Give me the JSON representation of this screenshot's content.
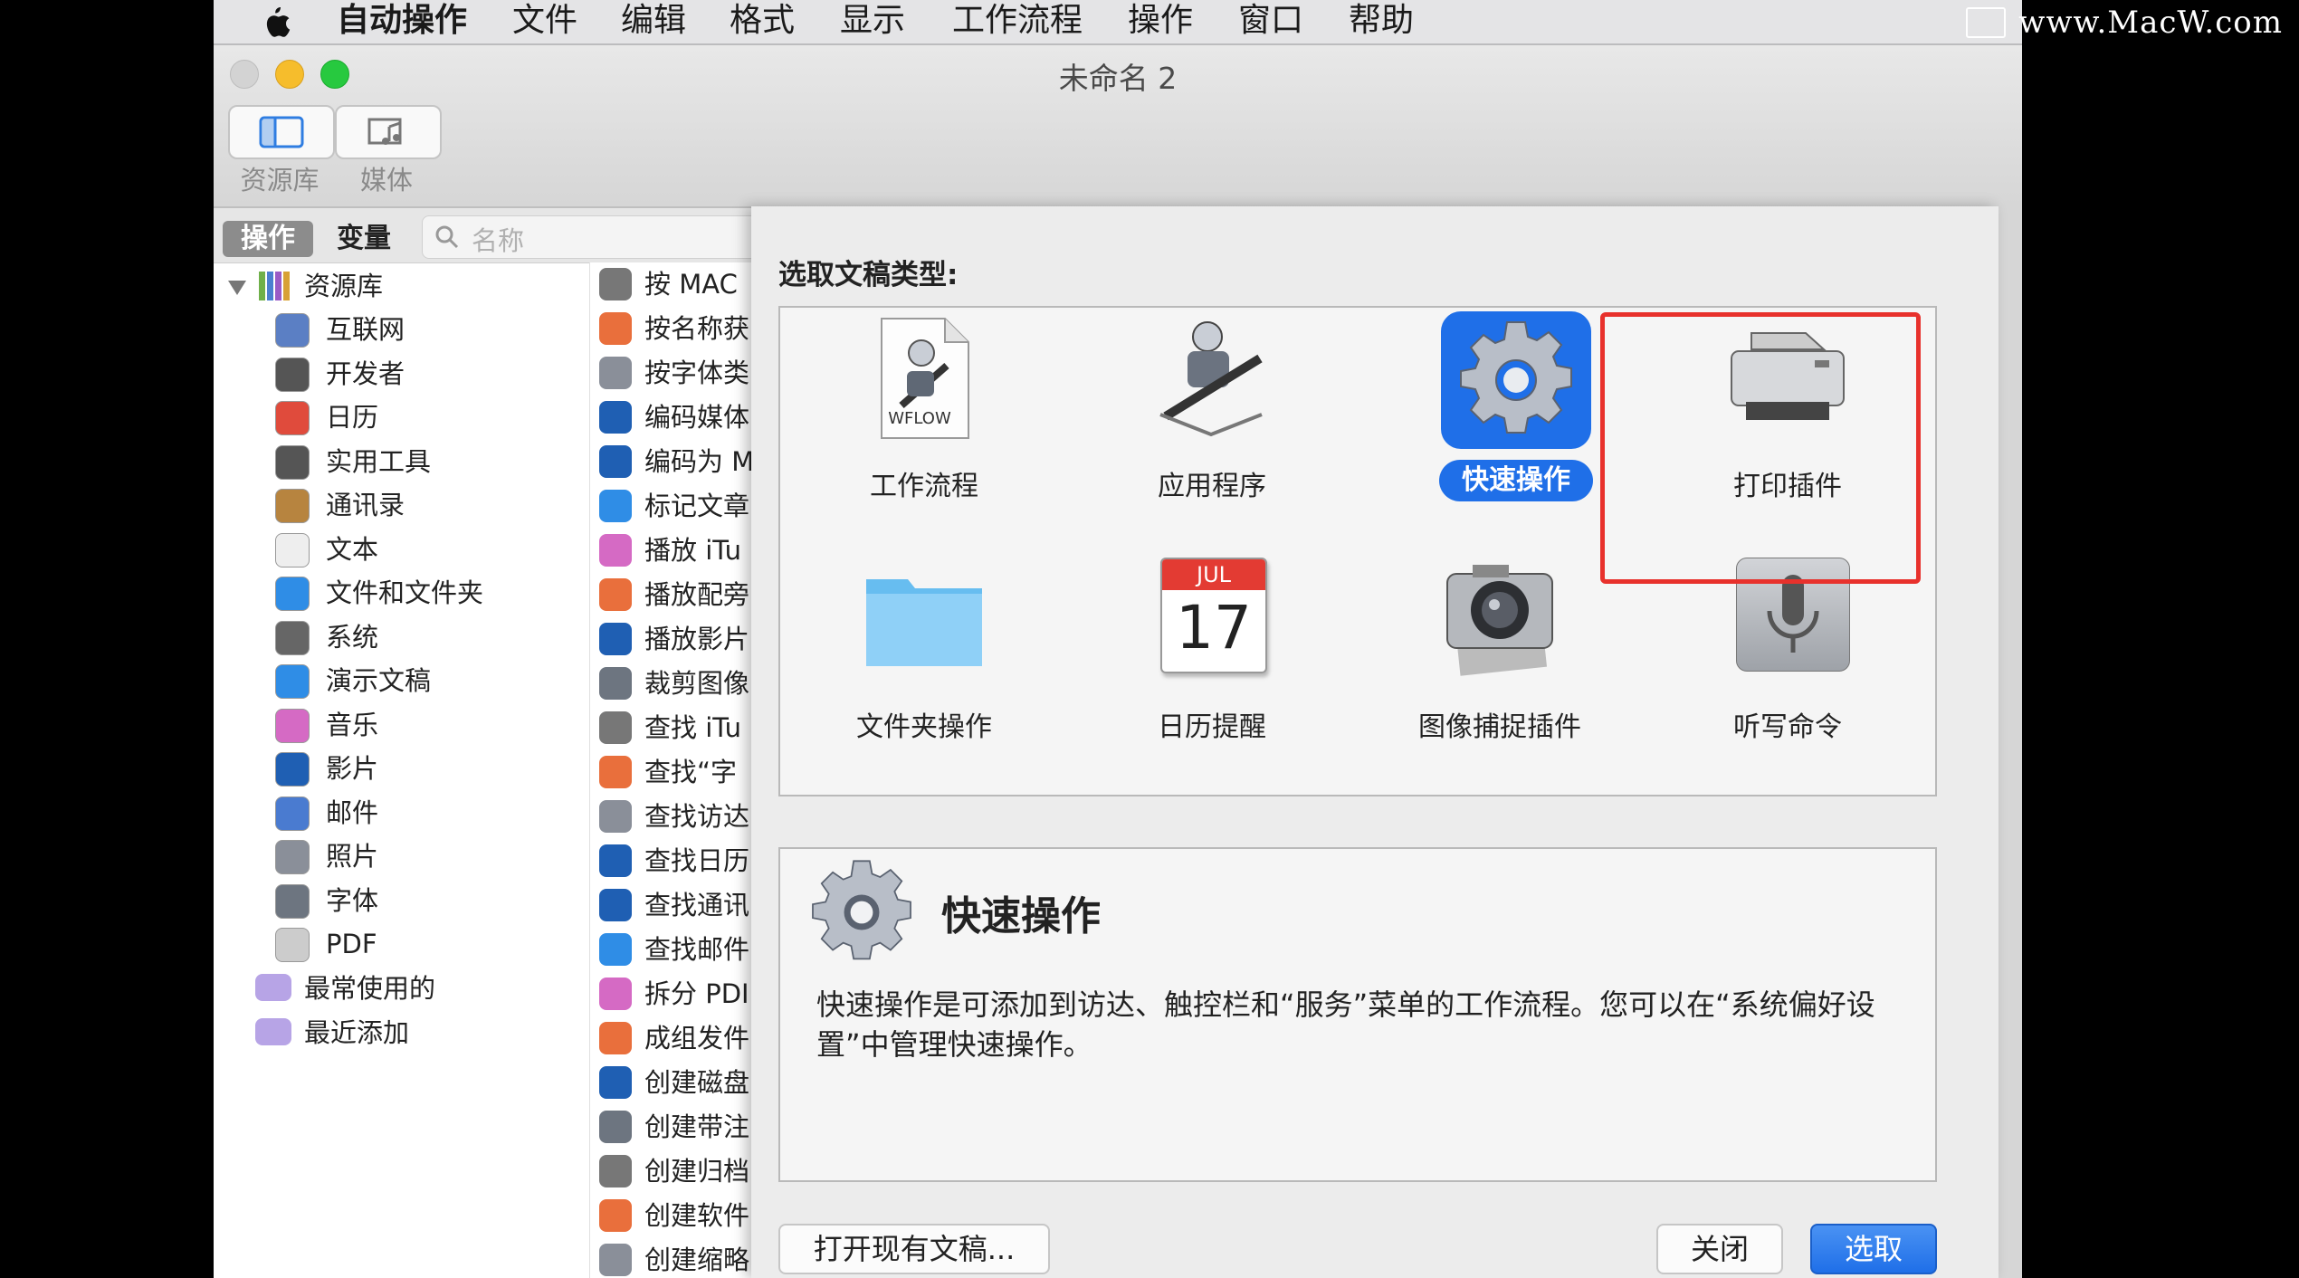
{
  "menubar": {
    "items": [
      "自动操作",
      "文件",
      "编辑",
      "格式",
      "显示",
      "工作流程",
      "操作",
      "窗口",
      "帮助"
    ]
  },
  "watermark": "www.MacW.com",
  "window": {
    "title": "未命名 2",
    "toolbar": {
      "library_label": "资源库",
      "media_label": "媒体"
    }
  },
  "leftpane": {
    "tabs": {
      "actions": "操作",
      "variables": "变量"
    },
    "search_placeholder": "名称",
    "library_root": "资源库",
    "categories": [
      "互联网",
      "开发者",
      "日历",
      "实用工具",
      "通讯录",
      "文本",
      "文件和文件夹",
      "系统",
      "演示文稿",
      "音乐",
      "影片",
      "邮件",
      "照片",
      "字体",
      "PDF"
    ],
    "smart_groups": [
      "最常使用的",
      "最近添加"
    ],
    "actions": [
      "按 MAC",
      "按名称获",
      "按字体类",
      "编码媒体",
      "编码为 M",
      "标记文章",
      "播放 iTu",
      "播放配旁",
      "播放影片",
      "裁剪图像",
      "查找 iTu",
      "查找“字",
      "查找访达",
      "查找日历",
      "查找通讯",
      "查找邮件",
      "拆分 PDI",
      "成组发件",
      "创建磁盘",
      "创建带注",
      "创建归档",
      "创建软件",
      "创建缩略"
    ]
  },
  "sheet": {
    "prompt": "选取文稿类型:",
    "types": [
      {
        "label": "工作流程",
        "icon": "workflow-icon",
        "badge": "WFLOW"
      },
      {
        "label": "应用程序",
        "icon": "application-icon"
      },
      {
        "label": "快速操作",
        "icon": "gear-icon"
      },
      {
        "label": "打印插件",
        "icon": "printer-icon"
      },
      {
        "label": "文件夹操作",
        "icon": "folder-icon"
      },
      {
        "label": "日历提醒",
        "icon": "calendar-icon",
        "month": "JUL",
        "day": "17"
      },
      {
        "label": "图像捕捉插件",
        "icon": "camera-icon"
      },
      {
        "label": "听写命令",
        "icon": "microphone-icon"
      }
    ],
    "selected_index": 2,
    "description": {
      "title": "快速操作",
      "text": "快速操作是可添加到访达、触控栏和“服务”菜单的工作流程。您可以在“系统偏好设置”中管理快速操作。"
    },
    "buttons": {
      "open_existing": "打开现有文稿...",
      "close": "关闭",
      "choose": "选取"
    }
  },
  "colors": {
    "accent": "#1f6fe8",
    "highlight": "#e8312c"
  }
}
